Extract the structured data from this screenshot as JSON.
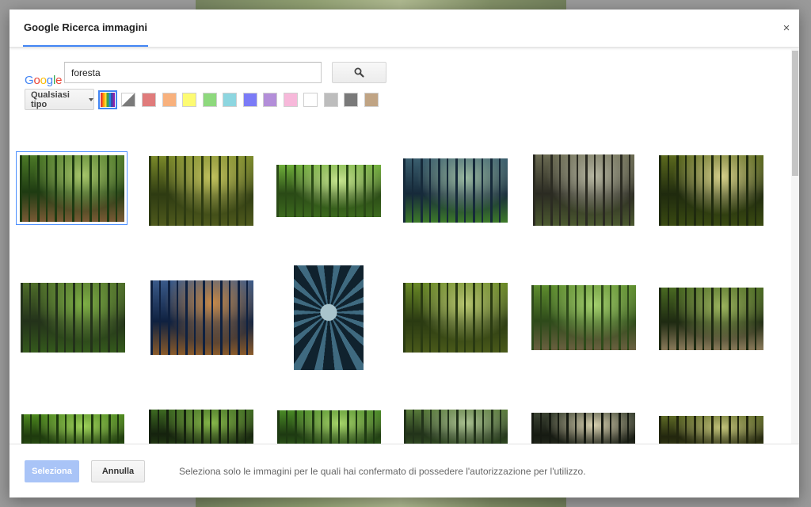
{
  "header": {
    "tab_title": "Google Ricerca immagini",
    "close_label": "×"
  },
  "search": {
    "logo_text": "Google",
    "query": "foresta",
    "search_icon": "search-icon"
  },
  "filters": {
    "type_label": "Qualsiasi tipo",
    "colors": [
      {
        "name": "all-colors",
        "value": "multicolor",
        "selected": true
      },
      {
        "name": "transparent",
        "value": "transparent"
      },
      {
        "name": "red",
        "value": "#e07b7b"
      },
      {
        "name": "orange",
        "value": "#f8b17d"
      },
      {
        "name": "yellow",
        "value": "#fdfb72"
      },
      {
        "name": "green",
        "value": "#8ed97d"
      },
      {
        "name": "teal",
        "value": "#8dd6e0"
      },
      {
        "name": "blue",
        "value": "#7b7bf7"
      },
      {
        "name": "purple",
        "value": "#b38ed9"
      },
      {
        "name": "pink",
        "value": "#f7b8da"
      },
      {
        "name": "white",
        "value": "#ffffff"
      },
      {
        "name": "gray",
        "value": "#bdbdbd"
      },
      {
        "name": "black",
        "value": "#7a7a7a"
      },
      {
        "name": "brown",
        "value": "#c0a484"
      }
    ]
  },
  "results": [
    {
      "id": 1,
      "selected": true,
      "colors": [
        "#1e3b12",
        "#4d7a27",
        "#a7c76b",
        "#7a5a35"
      ]
    },
    {
      "id": 2,
      "selected": false,
      "colors": [
        "#2e3b12",
        "#7b8a2a",
        "#c2c25e",
        "#4f5a1d"
      ]
    },
    {
      "id": 3,
      "selected": false,
      "colors": [
        "#2a4a16",
        "#6fae3a",
        "#c8e690",
        "#3d6a1e"
      ]
    },
    {
      "id": 4,
      "selected": false,
      "colors": [
        "#162a3a",
        "#3a5e6e",
        "#9ab8a0",
        "#3d7a2a"
      ]
    },
    {
      "id": 5,
      "selected": false,
      "colors": [
        "#2b2b22",
        "#6b6b52",
        "#b7b7a2",
        "#4c5a30"
      ]
    },
    {
      "id": 6,
      "selected": false,
      "colors": [
        "#1f2a0e",
        "#5c6a1e",
        "#d6d08a",
        "#3a4a12"
      ]
    },
    {
      "id": 7,
      "selected": false,
      "colors": [
        "#23321a",
        "#4f6e2a",
        "#7fb046",
        "#355a1c"
      ]
    },
    {
      "id": 8,
      "selected": false,
      "colors": [
        "#0f2140",
        "#3a5a8a",
        "#c78a4a",
        "#8a5a2a"
      ]
    },
    {
      "id": 9,
      "selected": false,
      "colors": [
        "#10222e",
        "#3f6a80",
        "#a9c4cc",
        "#2a4a5a"
      ]
    },
    {
      "id": 10,
      "selected": false,
      "colors": [
        "#2a3a12",
        "#6a8a26",
        "#b8c670",
        "#4a5a1a"
      ]
    },
    {
      "id": 11,
      "selected": false,
      "colors": [
        "#2e4a1a",
        "#5e8e2e",
        "#a4d06e",
        "#6a6040"
      ]
    },
    {
      "id": 12,
      "selected": false,
      "colors": [
        "#1e2a12",
        "#4a6a22",
        "#9cb45e",
        "#8a7a5a"
      ]
    },
    {
      "id": 13,
      "selected": false,
      "colors": [
        "#1e3a0e",
        "#4e8a1e",
        "#9ed25a",
        "#2e5a12"
      ]
    },
    {
      "id": 14,
      "selected": false,
      "colors": [
        "#15220e",
        "#3e6a22",
        "#86b84a",
        "#2a4a16"
      ]
    },
    {
      "id": 15,
      "selected": false,
      "colors": [
        "#1e3a12",
        "#4a8a26",
        "#a6d66a",
        "#35661c"
      ]
    },
    {
      "id": 16,
      "selected": false,
      "colors": [
        "#22331a",
        "#587a3a",
        "#a9c090",
        "#3a5a26"
      ]
    },
    {
      "id": 17,
      "selected": false,
      "colors": [
        "#161a12",
        "#3a4232",
        "#d8d0b0",
        "#2a3022"
      ]
    },
    {
      "id": 18,
      "selected": false,
      "colors": [
        "#22260e",
        "#5e6a26",
        "#c2c27a",
        "#3e4416"
      ]
    }
  ],
  "footer": {
    "select_label": "Seleziona",
    "cancel_label": "Annulla",
    "note": "Seleziona solo le immagini per le quali hai confermato di possedere l'autorizzazione per l'utilizzo."
  }
}
